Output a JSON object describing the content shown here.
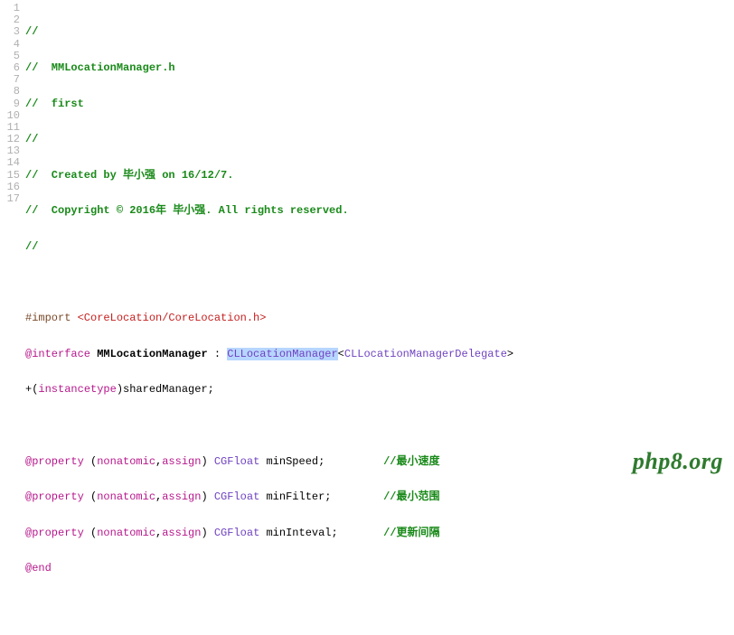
{
  "watermark": "php8.org",
  "gutter": [
    "1",
    "2",
    "3",
    "4",
    "5",
    "6",
    "7",
    "8",
    "9",
    "10",
    "11",
    "12",
    "13",
    "14",
    "15",
    "16",
    "17"
  ],
  "code": {
    "l1": {
      "c1": "//"
    },
    "l2": {
      "c1": "//  MMLocationManager.h"
    },
    "l3": {
      "c1": "//  first"
    },
    "l4": {
      "c1": "//"
    },
    "l5": {
      "c1": "//  Created by 毕小强 on 16/12/7."
    },
    "l6": {
      "c1": "//  Copyright © 2016年 毕小强. All rights reserved."
    },
    "l7": {
      "c1": "//"
    },
    "l8": {
      "c1": ""
    },
    "l9": {
      "pre": "#import ",
      "inc": "<CoreLocation/CoreLocation.h>"
    },
    "l10": {
      "kw": "@interface",
      "sp1": " ",
      "name": "MMLocationManager",
      "colon": " : ",
      "base": "CLLocationManager",
      "open": "<",
      "proto": "CLLocationManagerDelegate",
      "close": ">"
    },
    "l11": {
      "plus": "+(",
      "kw": "instancetype",
      "rest": ")sharedManager;"
    },
    "l12": {
      "c1": ""
    },
    "l13": {
      "kw": "@property",
      "sp1": " (",
      "a1": "nonatomic",
      "comma": ",",
      "a2": "assign",
      "sp2": ") ",
      "type": "CGFloat",
      "sp3": " ",
      "name": "minSpeed;",
      "pad": "         ",
      "cm": "//最小速度"
    },
    "l14": {
      "kw": "@property",
      "sp1": " (",
      "a1": "nonatomic",
      "comma": ",",
      "a2": "assign",
      "sp2": ") ",
      "type": "CGFloat",
      "sp3": " ",
      "name": "minFilter;",
      "pad": "        ",
      "cm": "//最小范围"
    },
    "l15": {
      "kw": "@property",
      "sp1": " (",
      "a1": "nonatomic",
      "comma": ",",
      "a2": "assign",
      "sp2": ") ",
      "type": "CGFloat",
      "sp3": " ",
      "name": "minInteval;",
      "pad": "       ",
      "cm": "//更新间隔"
    },
    "l16": {
      "kw": "@end"
    },
    "l17": {
      "c1": ""
    }
  }
}
